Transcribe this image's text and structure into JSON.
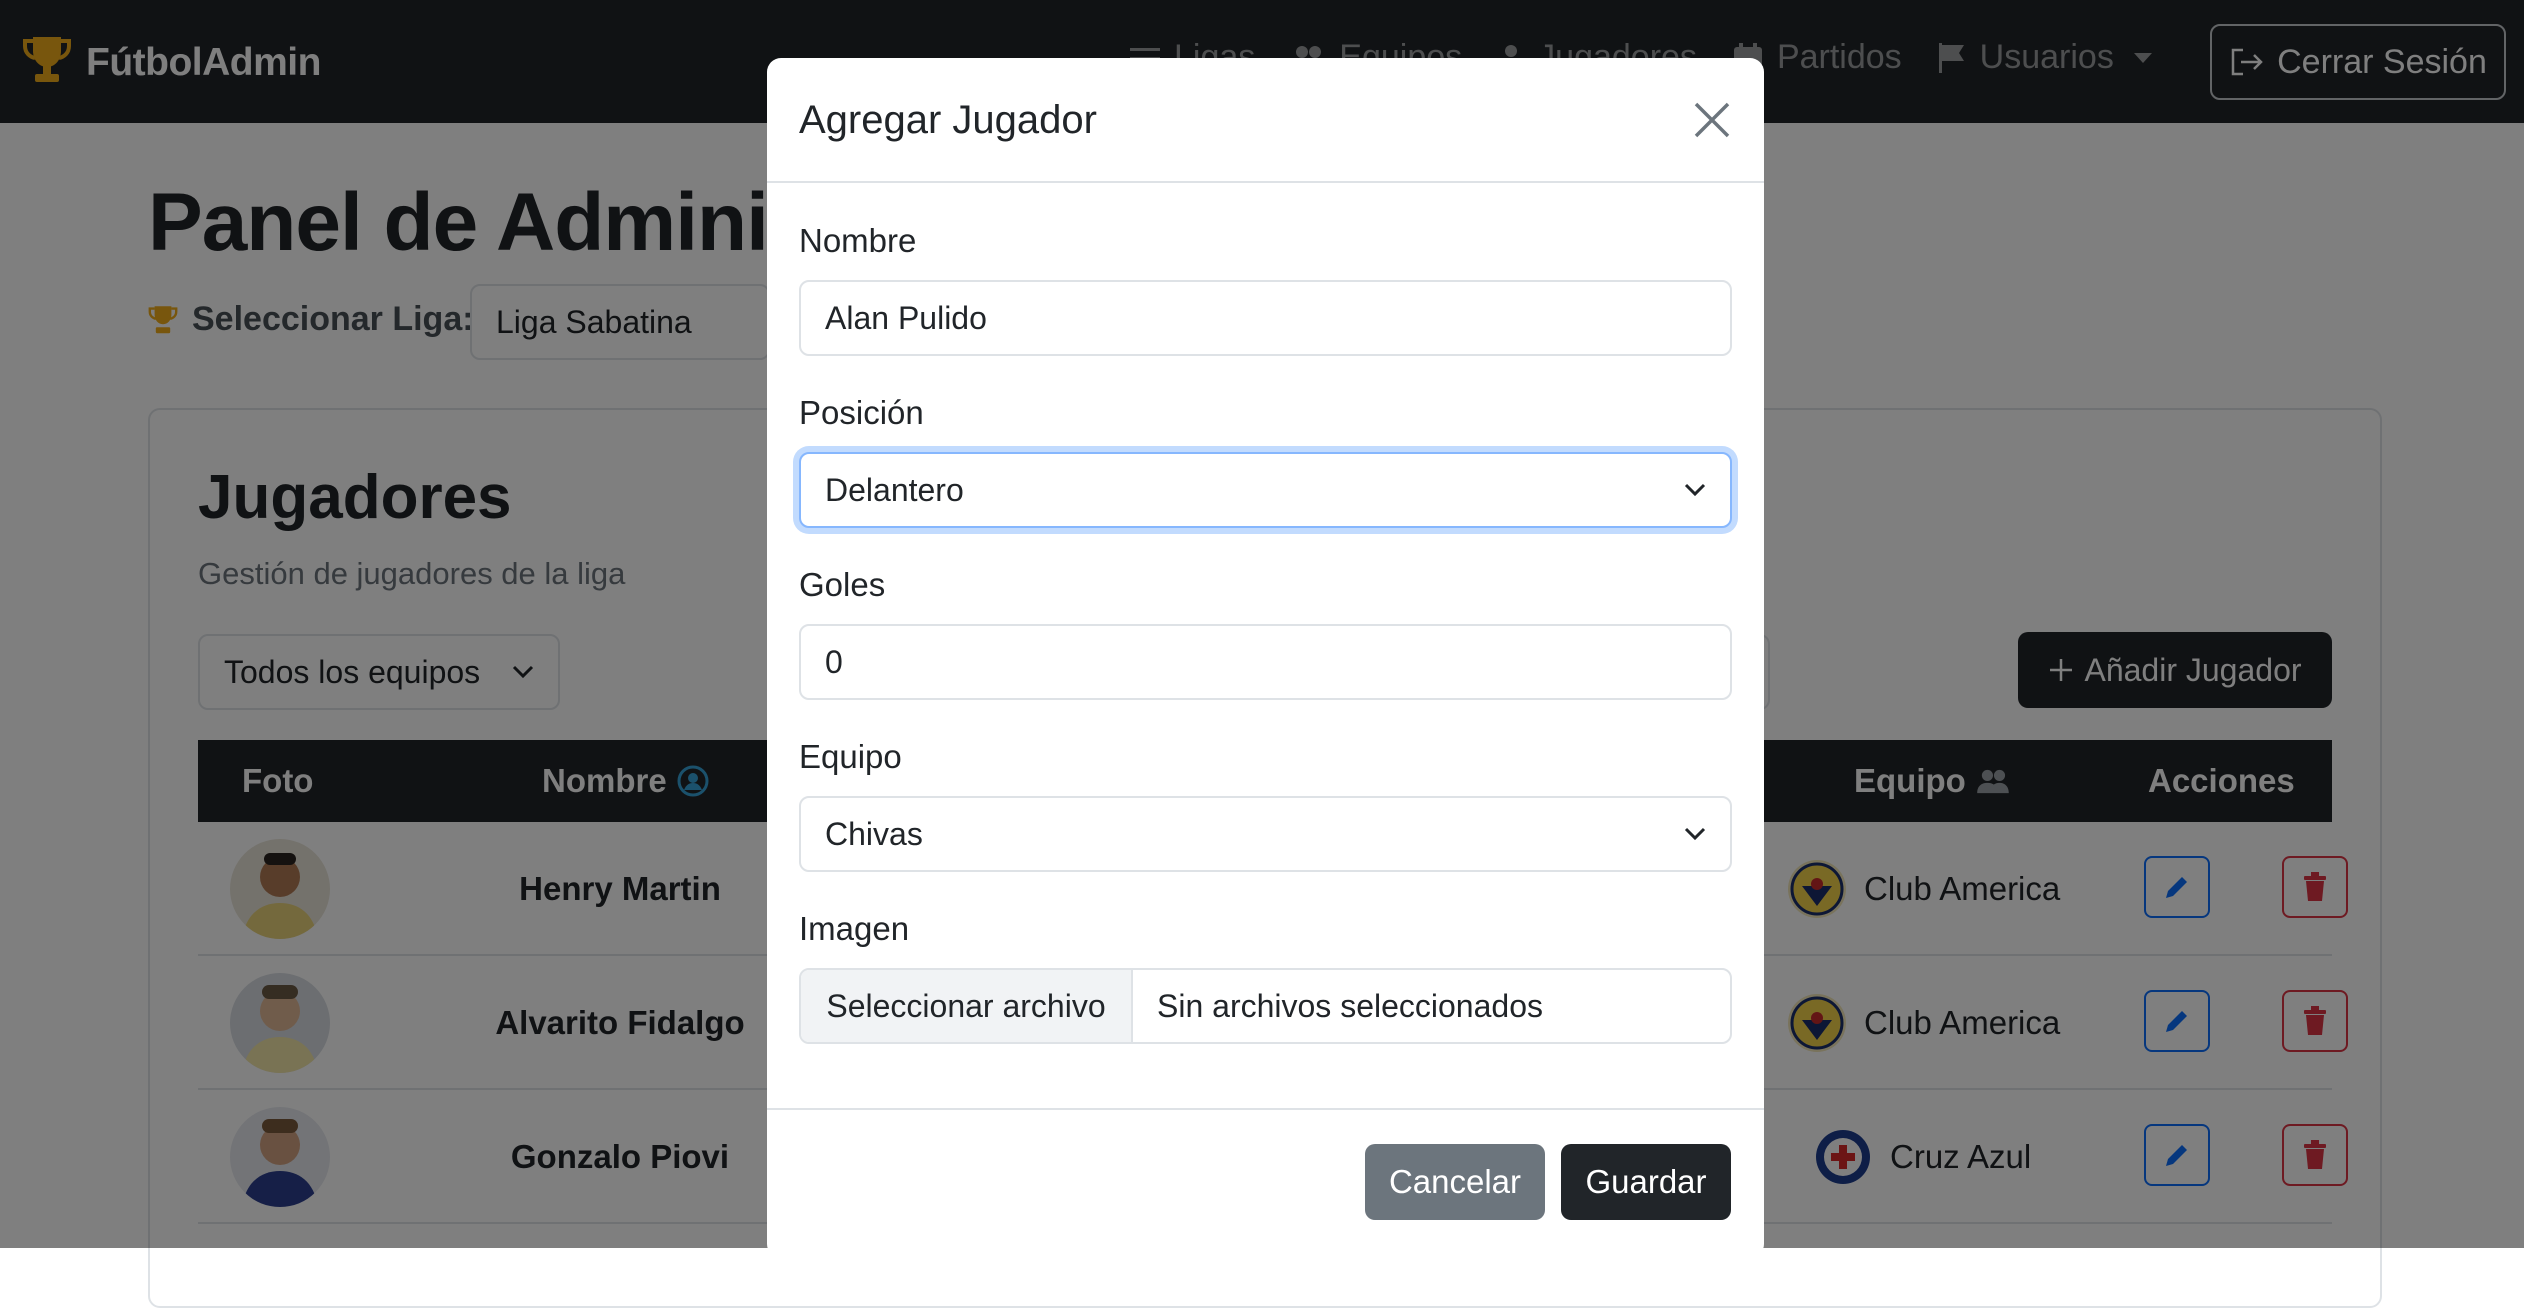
{
  "navbar": {
    "brand": "FútbolAdmin",
    "items": [
      {
        "label": "Ligas",
        "icon": "list-icon"
      },
      {
        "label": "Equipos",
        "icon": "users-icon"
      },
      {
        "label": "Jugadores",
        "icon": "person-icon"
      },
      {
        "label": "Partidos",
        "icon": "calendar-icon"
      },
      {
        "label": "Usuarios",
        "icon": "flag-icon"
      }
    ],
    "logout": "Cerrar Sesión"
  },
  "page": {
    "title": "Panel de Administración",
    "league_label": "Seleccionar Liga:",
    "league_value": "Liga Sabatina"
  },
  "players_card": {
    "title": "Jugadores",
    "subtitle": "Gestión de jugadores de la liga",
    "team_filter": "Todos los equipos",
    "add_button": "Añadir Jugador",
    "columns": {
      "photo": "Foto",
      "name": "Nombre",
      "team": "Equipo",
      "actions": "Acciones"
    },
    "rows": [
      {
        "name": "Henry Martin",
        "team": "Club America"
      },
      {
        "name": "Alvarito Fidalgo",
        "team": "Club America"
      },
      {
        "name": "Gonzalo Piovi",
        "team": "Cruz Azul"
      }
    ]
  },
  "modal": {
    "title": "Agregar Jugador",
    "fields": {
      "name_label": "Nombre",
      "name_value": "Alan Pulido",
      "position_label": "Posición",
      "position_value": "Delantero",
      "goals_label": "Goles",
      "goals_value": "0",
      "team_label": "Equipo",
      "team_value": "Chivas",
      "image_label": "Imagen",
      "file_button": "Seleccionar archivo",
      "file_status": "Sin archivos seleccionados"
    },
    "cancel": "Cancelar",
    "save": "Guardar"
  },
  "colors": {
    "navbar": "#212529",
    "trophy": "#f0ad1a",
    "primary": "#0d6efd",
    "danger": "#dc3545",
    "secondary": "#6c757d",
    "focus_ring": "#86b7fe"
  }
}
